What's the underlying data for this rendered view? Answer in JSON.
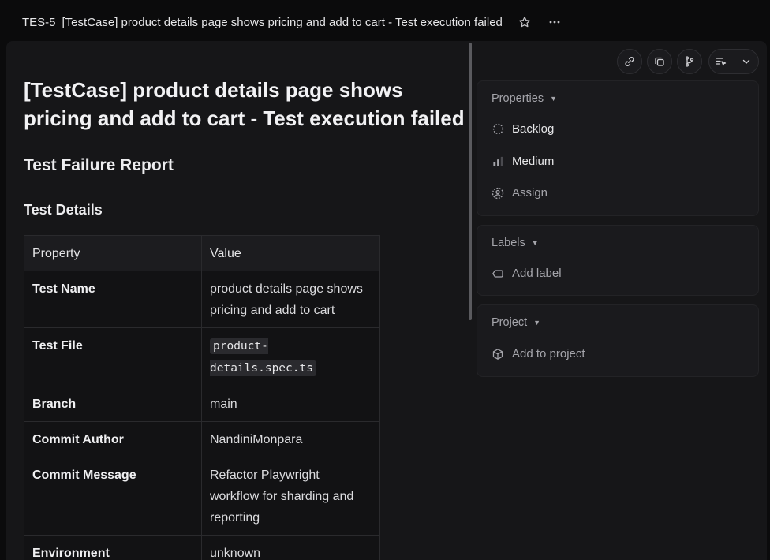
{
  "header": {
    "issue_id": "TES-5",
    "title": "[TestCase] product details page shows pricing and add to cart - Test execution failed"
  },
  "doc": {
    "title": "[TestCase] product details page shows pricing and add to cart - Test execution failed",
    "report_heading": "Test Failure Report",
    "details_heading": "Test Details",
    "table": {
      "columns": [
        "Property",
        "Value"
      ],
      "rows": [
        {
          "key": "Test Name",
          "value": "product details page shows pricing and add to cart"
        },
        {
          "key": "Test File",
          "value": "product-details.spec.ts"
        },
        {
          "key": "Branch",
          "value": "main"
        },
        {
          "key": "Commit Author",
          "value": "NandiniMonpara"
        },
        {
          "key": "Commit Message",
          "value": "Refactor Playwright workflow for sharding and reporting"
        },
        {
          "key": "Environment",
          "value": "unknown"
        }
      ]
    }
  },
  "sidebar": {
    "properties": {
      "label": "Properties",
      "status": "Backlog",
      "priority": "Medium",
      "assignee": "Assign"
    },
    "labels": {
      "label": "Labels",
      "add": "Add label"
    },
    "project": {
      "label": "Project",
      "add": "Add to project"
    }
  },
  "icons": {
    "star": "star-icon",
    "more": "more-horizontal-icon",
    "link": "link-icon",
    "copy": "copy-icon",
    "branch": "git-branch-icon",
    "subscribe": "subscribe-icon",
    "chevron": "chevron-down-icon"
  },
  "colors": {
    "background": "#0b0b0c",
    "panel": "#161618",
    "card": "#1a1a1d",
    "muted_text": "#a5a5ab"
  }
}
